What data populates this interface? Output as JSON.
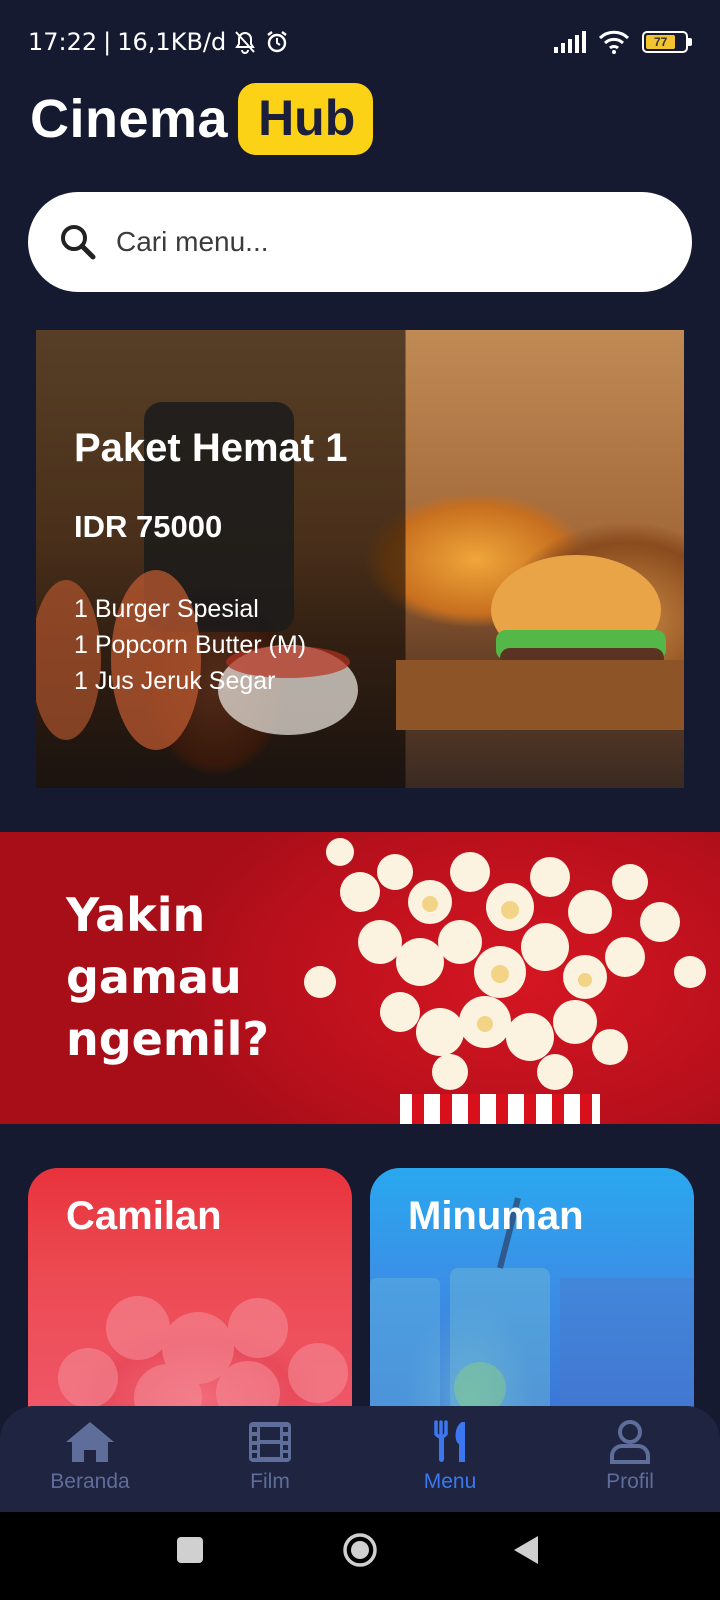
{
  "status_bar": {
    "time": "17:22",
    "speed": "16,1KB/d",
    "battery": "77",
    "icons": [
      "mute-icon",
      "alarm-icon",
      "signal-icon",
      "wifi-icon",
      "battery-icon"
    ]
  },
  "header": {
    "logo_main": "Cinema",
    "logo_badge": "Hub"
  },
  "search": {
    "placeholder": "Cari menu..."
  },
  "combo": {
    "title": "Paket Hemat 1",
    "price": "IDR 75000",
    "items": [
      "1 Burger Spesial",
      "1 Popcorn Butter (M)",
      "1 Jus Jeruk Segar"
    ]
  },
  "promo": {
    "text": "Yakin\ngamau\nngemil?"
  },
  "categories": [
    {
      "label": "Camilan"
    },
    {
      "label": "Minuman"
    }
  ],
  "bottom_nav": {
    "items": [
      {
        "label": "Beranda",
        "icon": "home-icon"
      },
      {
        "label": "Film",
        "icon": "film-icon"
      },
      {
        "label": "Menu",
        "icon": "utensils-icon"
      },
      {
        "label": "Profil",
        "icon": "user-icon"
      }
    ],
    "active": "Menu"
  },
  "colors": {
    "background": "#161a30",
    "accent_yellow": "#fcd217",
    "active_blue": "#3b78f0",
    "inactive_nav": "#5e6d9a",
    "promo_red": "#c3111d"
  }
}
